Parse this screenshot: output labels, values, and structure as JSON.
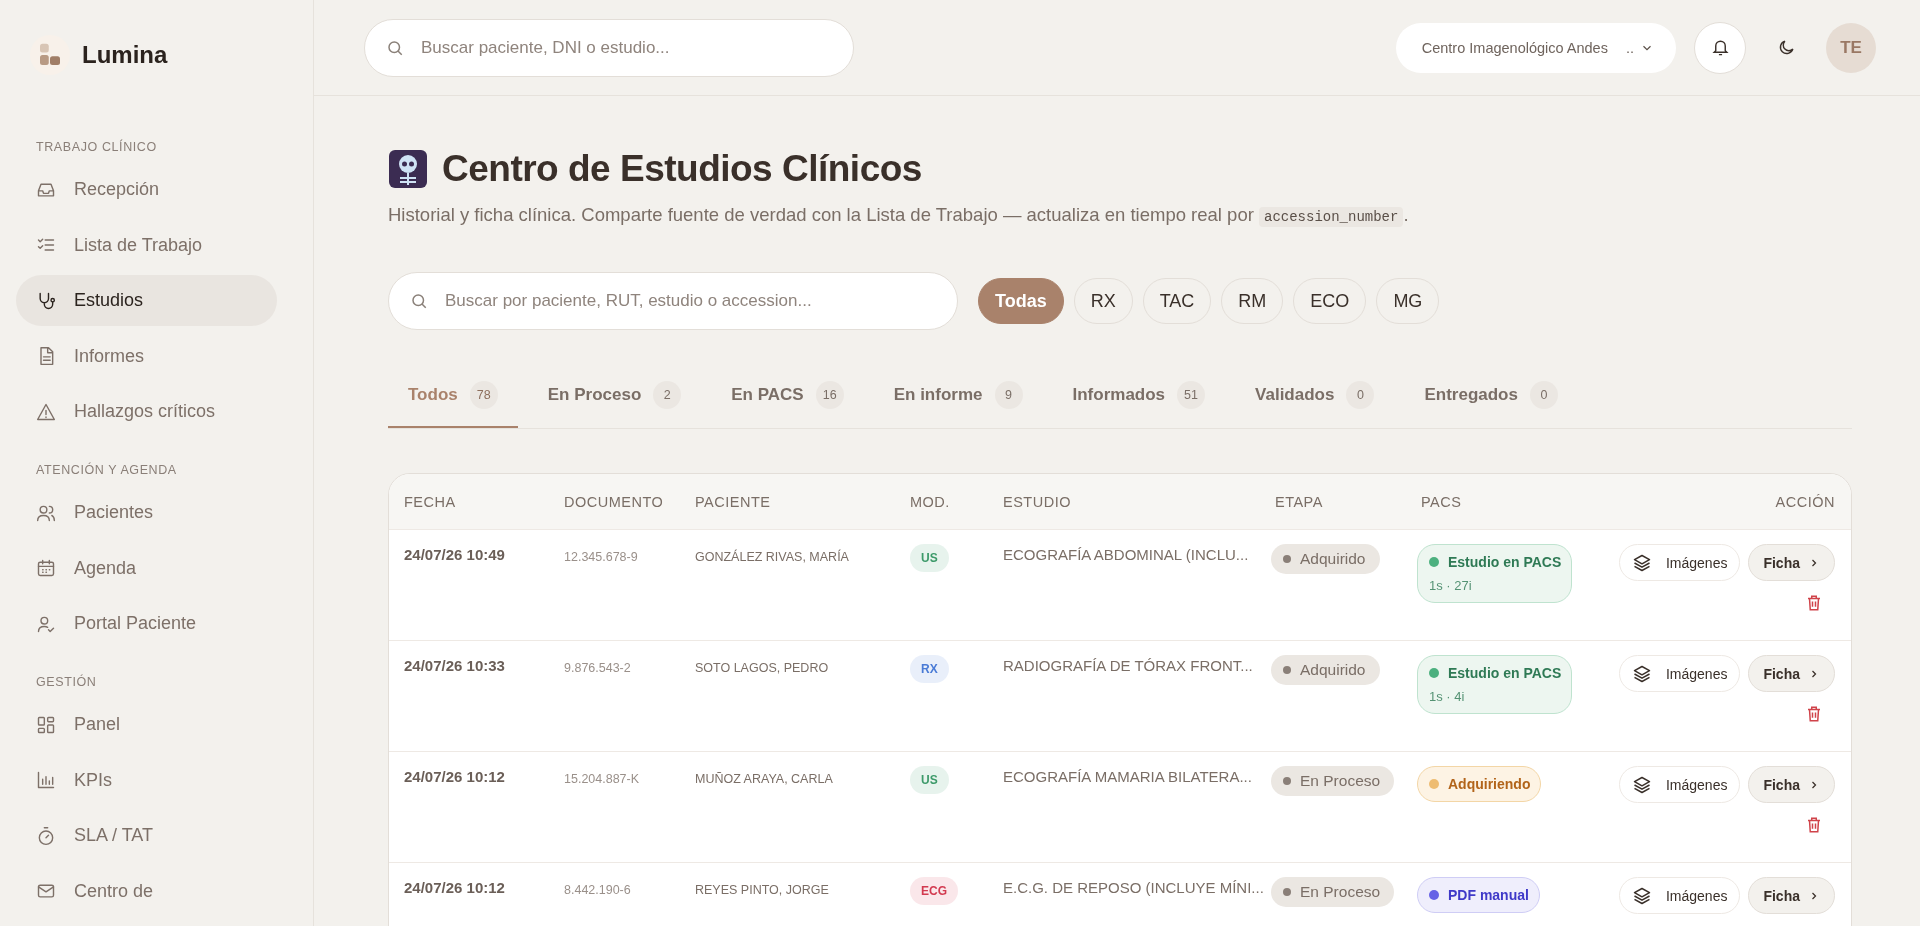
{
  "brand": {
    "name": "Lumina"
  },
  "sidebar": {
    "sections": [
      {
        "title": "TRABAJO CLÍNICO",
        "items": [
          {
            "label": "Recepción",
            "selected": false
          },
          {
            "label": "Lista de Trabajo",
            "selected": false
          },
          {
            "label": "Estudios",
            "selected": true
          },
          {
            "label": "Informes",
            "selected": false
          },
          {
            "label": "Hallazgos críticos",
            "selected": false
          }
        ]
      },
      {
        "title": "ATENCIÓN Y AGENDA",
        "items": [
          {
            "label": "Pacientes",
            "selected": false
          },
          {
            "label": "Agenda",
            "selected": false
          },
          {
            "label": "Portal Paciente",
            "selected": false
          }
        ]
      },
      {
        "title": "GESTIÓN",
        "items": [
          {
            "label": "Panel",
            "selected": false
          },
          {
            "label": "KPIs",
            "selected": false
          },
          {
            "label": "SLA / TAT",
            "selected": false
          },
          {
            "label": "Centro de",
            "selected": false
          }
        ]
      }
    ]
  },
  "topbar": {
    "search": {
      "placeholder": "Buscar paciente, DNI o estudio..."
    },
    "center_select": {
      "value": "Centro Imagenológico Andes",
      "suffix": ".."
    },
    "avatar": "TE"
  },
  "header": {
    "title": "Centro de Estudios Clínicos",
    "subtitle": "Historial y ficha clínica. Comparte fuente de verdad con la Lista de Trabajo — actualiza en tiempo real por",
    "code": "accession_number",
    "subtitle_end": "."
  },
  "filters": {
    "search": {
      "placeholder": "Buscar por paciente, RUT, estudio o accession..."
    },
    "modalities": [
      {
        "label": "Todas",
        "selected": true
      },
      {
        "label": "RX",
        "selected": false
      },
      {
        "label": "TAC",
        "selected": false
      },
      {
        "label": "RM",
        "selected": false
      },
      {
        "label": "ECO",
        "selected": false
      },
      {
        "label": "MG",
        "selected": false
      }
    ]
  },
  "tabs": [
    {
      "label": "Todos",
      "count": "78",
      "selected": true
    },
    {
      "label": "En Proceso",
      "count": "2",
      "selected": false
    },
    {
      "label": "En PACS",
      "count": "16",
      "selected": false
    },
    {
      "label": "En informe",
      "count": "9",
      "selected": false
    },
    {
      "label": "Informados",
      "count": "51",
      "selected": false
    },
    {
      "label": "Validados",
      "count": "0",
      "selected": false
    },
    {
      "label": "Entregados",
      "count": "0",
      "selected": false
    }
  ],
  "table": {
    "columns": [
      "FECHA",
      "DOCUMENTO",
      "PACIENTE",
      "MOD.",
      "ESTUDIO",
      "ETAPA",
      "PACS",
      "ACCIÓN"
    ],
    "rows": [
      {
        "fecha": "24/07/26 10:49",
        "documento": "12.345.678-9",
        "paciente": "GONZÁLEZ RIVAS, MARÍA",
        "mod": {
          "label": "US",
          "color": "#3d9a6a"
        },
        "estudio": "ECOGRAFÍA ABDOMINAL (INCLU...",
        "etapa": "Adquirido",
        "pacs": {
          "kind": "ok",
          "label": "Estudio en PACS",
          "detail": "1s · 27i",
          "color": "#4cb07f"
        },
        "images": "Imágenes",
        "ficha": "Ficha"
      },
      {
        "fecha": "24/07/26 10:33",
        "documento": "9.876.543-2",
        "paciente": "SOTO LAGOS, PEDRO",
        "mod": {
          "label": "RX",
          "color": "#4a7bd6"
        },
        "estudio": "RADIOGRAFÍA DE TÓRAX FRONT...",
        "etapa": "Adquirido",
        "pacs": {
          "kind": "ok",
          "label": "Estudio en PACS",
          "detail": "1s · 4i",
          "color": "#4cb07f"
        },
        "images": "Imágenes",
        "ficha": "Ficha"
      },
      {
        "fecha": "24/07/26 10:12",
        "documento": "15.204.887-K",
        "paciente": "MUÑOZ ARAYA, CARLA",
        "mod": {
          "label": "US",
          "color": "#3d9a6a"
        },
        "estudio": "ECOGRAFÍA MAMARIA BILATERA...",
        "etapa": "En Proceso",
        "pacs": {
          "kind": "pending",
          "label": "Adquiriendo",
          "color": "#eebc72"
        },
        "images": "Imágenes",
        "ficha": "Ficha"
      },
      {
        "fecha": "24/07/26 10:12",
        "documento": "8.442.190-6",
        "paciente": "REYES PINTO, JORGE",
        "mod": {
          "label": "ECG",
          "color": "#d2394f"
        },
        "estudio": "E.C.G. DE REPOSO (INCLUYE MÍNI...",
        "etapa": "En Proceso",
        "pacs": {
          "kind": "manual",
          "label": "PDF manual",
          "color": "#6662e6"
        },
        "images": "Imágenes",
        "ficha": "Ficha"
      }
    ]
  }
}
